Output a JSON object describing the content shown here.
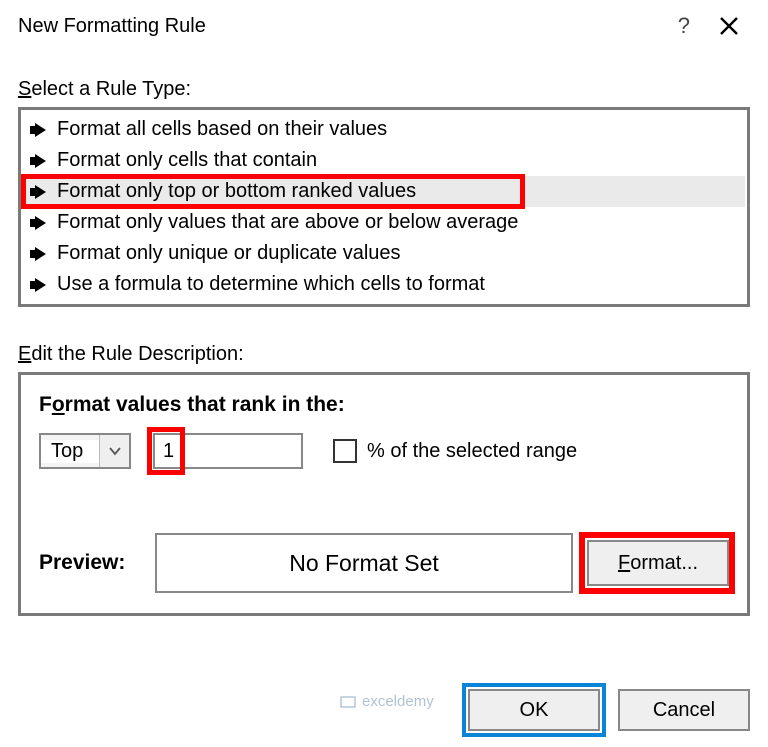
{
  "titlebar": {
    "title": "New Formatting Rule",
    "help_icon": "?",
    "close_icon": "close-icon"
  },
  "rule_type_label": "Select a Rule Type:",
  "rule_types": [
    "Format all cells based on their values",
    "Format only cells that contain",
    "Format only top or bottom ranked values",
    "Format only values that are above or below average",
    "Format only unique or duplicate values",
    "Use a formula to determine which cells to format"
  ],
  "selected_rule_index": 2,
  "desc_label": "Edit the Rule Description:",
  "desc_subtitle": "Format values that rank in the:",
  "rank_select": {
    "value": "Top"
  },
  "rank_value": "1",
  "percent_checkbox": {
    "checked": false,
    "label": "% of the selected range"
  },
  "preview": {
    "label": "Preview:",
    "text": "No Format Set",
    "format_btn": "Format..."
  },
  "footer": {
    "ok": "OK",
    "cancel": "Cancel"
  },
  "watermark": "exceldemy"
}
